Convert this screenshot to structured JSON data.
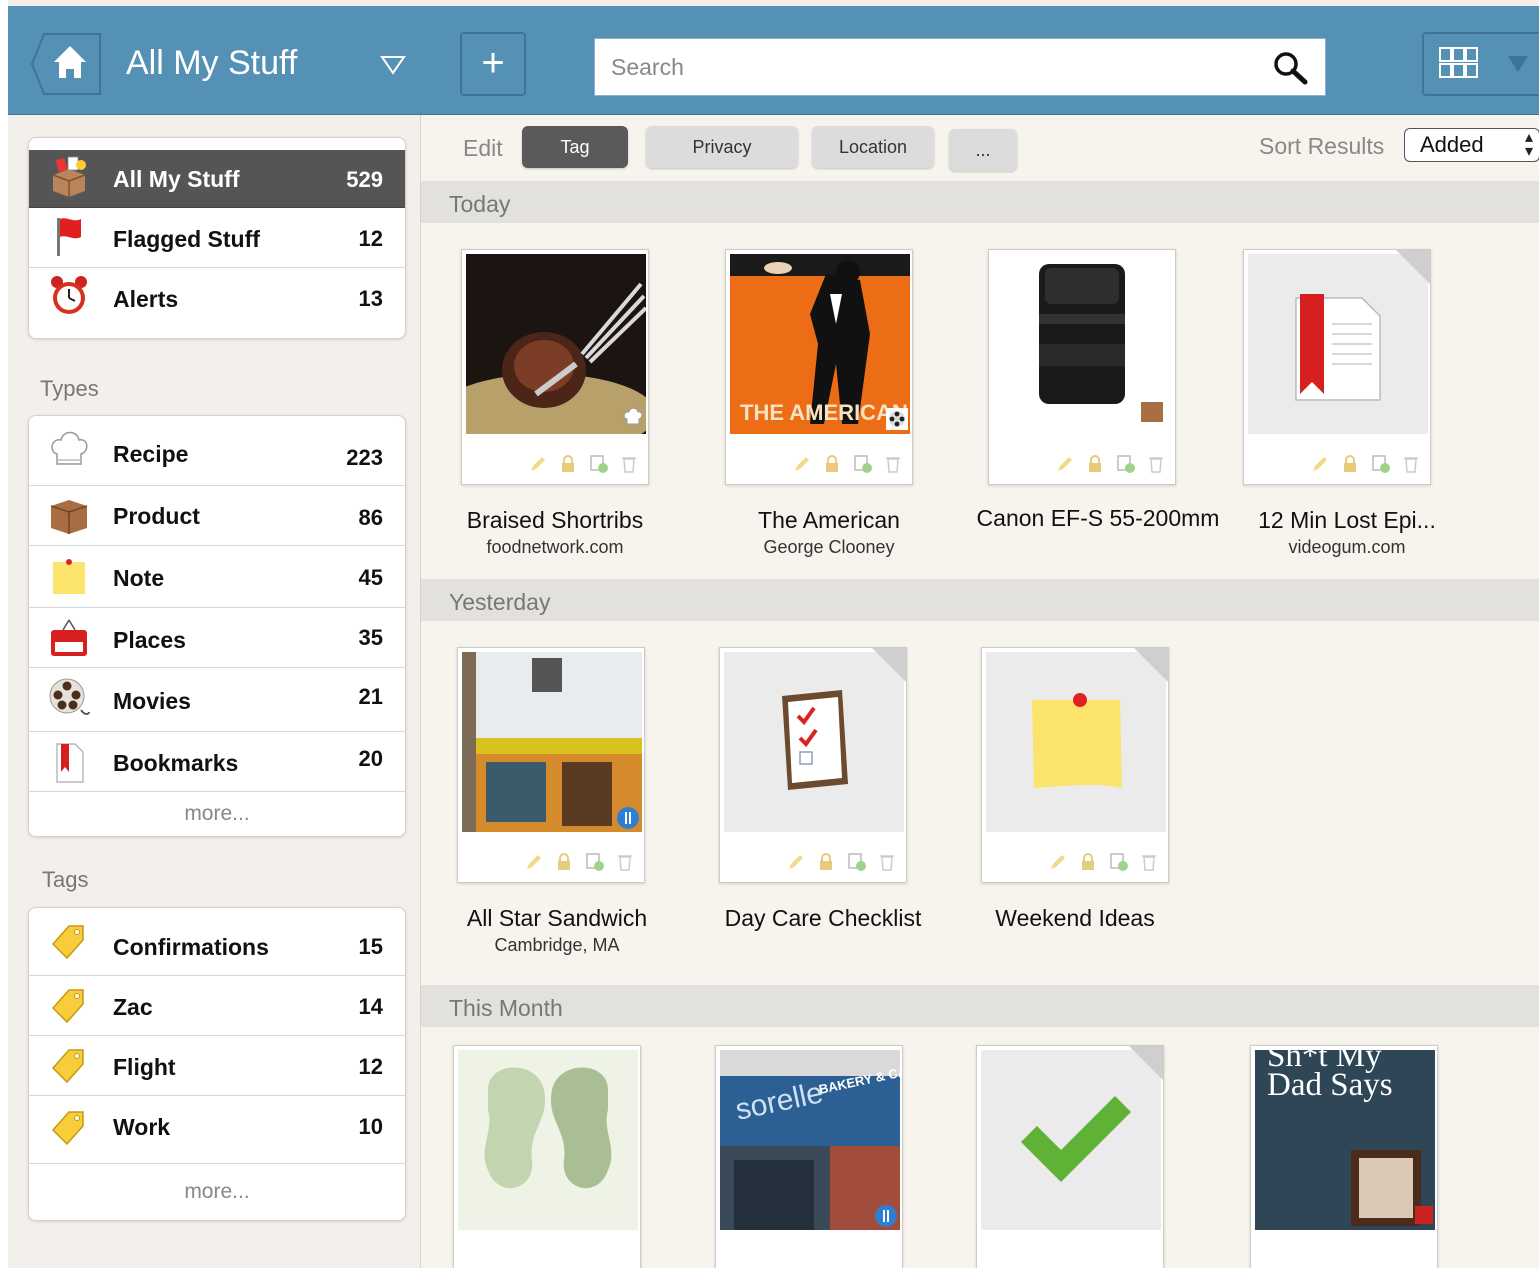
{
  "header": {
    "title": "All My Stuff",
    "add_label": "+",
    "search_placeholder": "Search"
  },
  "sidebar": {
    "main_items": [
      {
        "label": "All My Stuff",
        "count": "529",
        "icon": "box-icon"
      },
      {
        "label": "Flagged Stuff",
        "count": "12",
        "icon": "flag-icon"
      },
      {
        "label": "Alerts",
        "count": "13",
        "icon": "alarm-clock-icon"
      }
    ],
    "types_heading": "Types",
    "types": [
      {
        "label": "Recipe",
        "count": "223",
        "icon": "chef-hat-icon"
      },
      {
        "label": "Product",
        "count": "86",
        "icon": "package-icon"
      },
      {
        "label": "Note",
        "count": "45",
        "icon": "sticky-note-icon"
      },
      {
        "label": "Places",
        "count": "35",
        "icon": "open-sign-icon"
      },
      {
        "label": "Movies",
        "count": "21",
        "icon": "film-reel-icon"
      },
      {
        "label": "Bookmarks",
        "count": "20",
        "icon": "bookmark-icon"
      }
    ],
    "types_more": "more...",
    "tags_heading": "Tags",
    "tags": [
      {
        "label": "Confirmations",
        "count": "15",
        "icon": "tag-icon"
      },
      {
        "label": "Zac",
        "count": "14",
        "icon": "tag-icon"
      },
      {
        "label": "Flight",
        "count": "12",
        "icon": "tag-icon"
      },
      {
        "label": "Work",
        "count": "10",
        "icon": "tag-icon"
      }
    ],
    "tags_more": "more..."
  },
  "toolbar": {
    "edit_label": "Edit",
    "buttons": [
      "Tag",
      "Privacy",
      "Location",
      "..."
    ],
    "sort_label": "Sort Results",
    "sort_value": "Added"
  },
  "groups": [
    {
      "label": "Today",
      "items": [
        {
          "title": "Braised Shortribs",
          "subtitle": "foodnetwork.com"
        },
        {
          "title": "The American",
          "subtitle": "George Clooney"
        },
        {
          "title": "Canon EF-S 55-200mm",
          "subtitle": ""
        },
        {
          "title": "12 Min Lost Epi...",
          "subtitle": "videogum.com"
        }
      ]
    },
    {
      "label": "Yesterday",
      "items": [
        {
          "title": "All Star Sandwich",
          "subtitle": "Cambridge, MA"
        },
        {
          "title": "Day Care Checklist",
          "subtitle": ""
        },
        {
          "title": "Weekend Ideas",
          "subtitle": ""
        }
      ]
    },
    {
      "label": "This Month",
      "items": [
        {
          "title": "",
          "subtitle": ""
        },
        {
          "title": "",
          "subtitle": ""
        },
        {
          "title": "",
          "subtitle": ""
        },
        {
          "title": "",
          "subtitle": ""
        }
      ]
    }
  ],
  "thumb_text": {
    "movie_poster": "THE AMERICAN",
    "bakery_sign": "sorelle",
    "bakery_sign2": "BAKERY & CAFE",
    "book_title": "Sh*t My Dad Says"
  },
  "colors": {
    "header_bg": "#5590b5",
    "active_row": "#555555",
    "pill_dark": "#5a5a5a"
  }
}
